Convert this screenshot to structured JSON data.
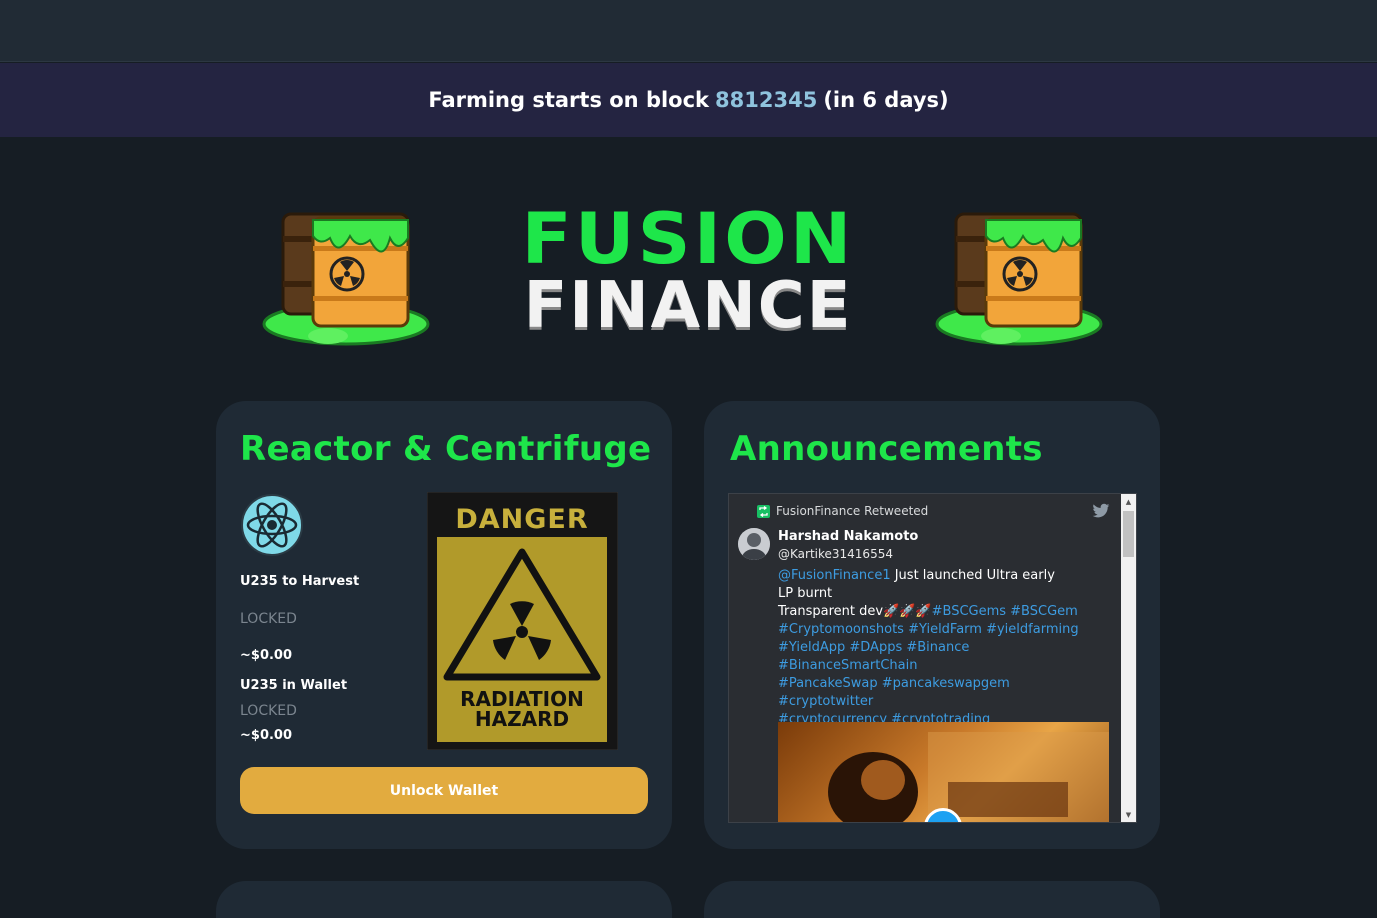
{
  "banner": {
    "prefix": "Farming starts on block",
    "block": "8812345",
    "suffix": "(in 6 days)"
  },
  "logo": {
    "line1": "FUSION",
    "line2": "FINANCE"
  },
  "reactor": {
    "title": "Reactor & Centrifuge",
    "harvest_label": "U235 to Harvest",
    "harvest_status": "LOCKED",
    "harvest_value": "~$0.00",
    "wallet_label": "U235 in Wallet",
    "wallet_status": "LOCKED",
    "wallet_value": "~$0.00",
    "danger_top": "DANGER",
    "danger_bottom1": "RADIATION",
    "danger_bottom2": "HAZARD",
    "unlock_label": "Unlock Wallet"
  },
  "announcements": {
    "title": "Announcements",
    "tweet": {
      "retweeted_by": "FusionFinance Retweeted",
      "author_name": "Harshad Nakamoto",
      "author_handle": "@Kartike31416554",
      "mention": "@FusionFinance1",
      "text1": " Just launched Ultra early",
      "text2": " LP burnt",
      "text3": "Transparent dev🚀🚀🚀",
      "hashtags1": "#BSCGems #BSCGem",
      "hashtags2": "#Cryptomoonshots #YieldFarm #yieldfarming",
      "hashtags3": "#YieldApp #DApps #Binance #BinanceSmartChain",
      "hashtags4": "#PancakeSwap #pancakeswapgem #cryptotwitter",
      "hashtags5": "#cryptocurrency #cryptotrading"
    }
  },
  "colors": {
    "accent_green": "#1ee64a",
    "button_gold": "#e2ab3f",
    "link_blue": "#3d9ce1",
    "card_bg": "#1f2a35"
  }
}
